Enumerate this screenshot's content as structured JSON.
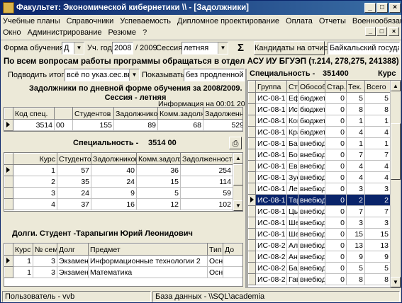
{
  "window": {
    "title": "Факультет: Экономической кибернетики \\\\ - [Задолжники]",
    "icon": "app-icon"
  },
  "menu": {
    "row1": [
      "Учебные планы",
      "Справочники",
      "Успеваемость",
      "Дипломное проектирование",
      "Оплата",
      "Отчеты",
      "Военнообязанные"
    ],
    "row2": [
      "Окно",
      "Администрирование",
      "Резюме",
      "?"
    ]
  },
  "toolbar": {
    "form_label": "Форма обучения:",
    "form_value": "Д",
    "year_label": "Уч. год:",
    "year_value": "2008",
    "year_suffix": "/ 2009",
    "session_label": "Сессия:",
    "session_value": "летняя",
    "sigma": "Σ",
    "candidates_btn": "Кандидаты на отчисл.",
    "university": "Байкальский государс"
  },
  "notice": "По всем вопросам работы программы обращаться  в отдел АСУ ИУ БГУЭП  (т.214, 278,275, 241388)",
  "summary": {
    "label": "Подводить итоги",
    "value": "всё по указ.сес.вкл.",
    "show_label": "Показывать",
    "show_value": "без продленной се"
  },
  "report": {
    "title1": "Задолжники по дневной форме обучения за 2008/2009.",
    "title2": "Сессия - летняя",
    "info": "Информация на 00:01  20.0",
    "headers": [
      "Код спец.",
      "",
      "Студентов",
      "Задолжников",
      "Комм.задолж.",
      "Задолженности"
    ],
    "row": [
      "3514",
      "00",
      "155",
      "89",
      "68",
      "529"
    ]
  },
  "spec": {
    "label": "Специальность -",
    "value": "3514 00",
    "headers": [
      "Курс",
      "Студентов",
      "Задолжников",
      "Комм.задолж.",
      "Задолженностей"
    ],
    "rows": [
      [
        "1",
        "57",
        "40",
        "36",
        "254"
      ],
      [
        "2",
        "35",
        "24",
        "15",
        "114"
      ],
      [
        "3",
        "24",
        "9",
        "5",
        "59"
      ],
      [
        "4",
        "37",
        "16",
        "12",
        "102"
      ]
    ]
  },
  "debts": {
    "title": "Долги. Студент -Тарапыгин Юрий Леонидович",
    "headers": [
      "Курс",
      "№ сем.",
      "Долг",
      "Предмет",
      "Тип",
      "До"
    ],
    "rows": [
      [
        "1",
        "3",
        "Экзамен",
        "Информационные технологии 2",
        "Осн",
        ""
      ],
      [
        "1",
        "3",
        "Экзамен",
        "Математика",
        "Осн",
        ""
      ]
    ]
  },
  "groups": {
    "spec_label": "Специальность -",
    "spec_value": "351400",
    "course_label": "Курс",
    "headers": [
      "Группа",
      "Сту",
      "Обособ.",
      "Стар.",
      "Тек.",
      "Всего"
    ],
    "rows": [
      [
        "ИС-08-1",
        "Ефі",
        "бюджет",
        "0",
        "5",
        "5"
      ],
      [
        "ИС-08-1",
        "Иса",
        "бюджет",
        "0",
        "8",
        "8"
      ],
      [
        "ИС-08-1",
        "Кон",
        "бюджет",
        "0",
        "1",
        "1"
      ],
      [
        "ИС-08-1",
        "Кра",
        "бюджет",
        "0",
        "4",
        "4"
      ],
      [
        "ИС-08-1",
        "Бак",
        "внебюд",
        "0",
        "1",
        "1"
      ],
      [
        "ИС-08-1",
        "Боб",
        "внебюд",
        "0",
        "7",
        "7"
      ],
      [
        "ИС-08-1",
        "Евс",
        "внебюд",
        "0",
        "4",
        "4"
      ],
      [
        "ИС-08-1",
        "Зуе",
        "внебюд",
        "0",
        "4",
        "4"
      ],
      [
        "ИС-08-1",
        "Лес",
        "внебюд",
        "0",
        "3",
        "3"
      ],
      [
        "ИС-08-1",
        "Тар",
        "внебюд",
        "0",
        "2",
        "2"
      ],
      [
        "ИС-08-1",
        "Цый",
        "внебюд",
        "0",
        "7",
        "7"
      ],
      [
        "ИС-08-1",
        "Шел",
        "внебюд",
        "0",
        "3",
        "3"
      ],
      [
        "ИС-08-1",
        "Шеі",
        "внебюд",
        "0",
        "15",
        "15"
      ],
      [
        "ИС-08-2",
        "Алт",
        "внебюд",
        "0",
        "13",
        "13"
      ],
      [
        "ИС-08-2",
        "Ант",
        "внебюд",
        "0",
        "9",
        "9"
      ],
      [
        "ИС-08-2",
        "Бар",
        "внебюд",
        "0",
        "5",
        "5"
      ],
      [
        "ИС-08-2",
        "Гав",
        "внебюд",
        "0",
        "8",
        "8"
      ]
    ],
    "selected_index": 9
  },
  "status": {
    "user": "Пользователь - vvb",
    "db": "База данных - \\\\SQL\\academia"
  }
}
